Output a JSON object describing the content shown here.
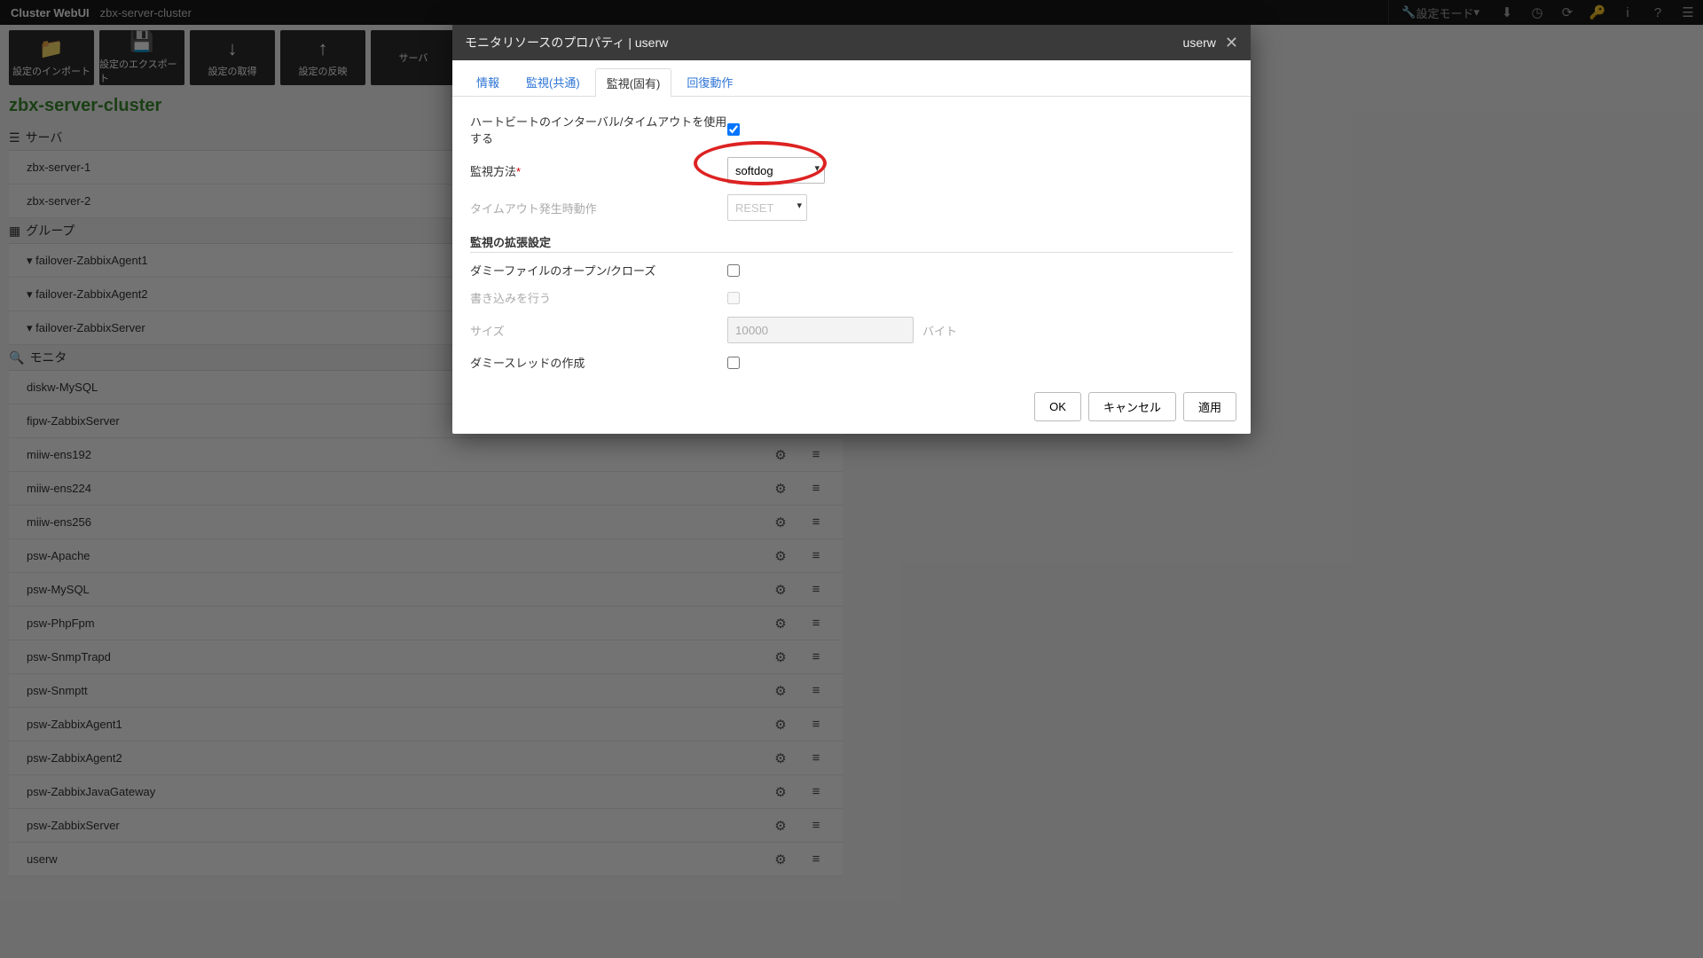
{
  "topbar": {
    "brand_bold": "Cluster WebUI",
    "cluster": "zbx-server-cluster",
    "mode_label": "設定モード",
    "icons": [
      "download",
      "history",
      "refresh",
      "key",
      "info",
      "help",
      "list"
    ]
  },
  "toolbar": [
    {
      "icon": "folder",
      "label": "設定のインポート"
    },
    {
      "icon": "disk",
      "label": "設定のエクスポート"
    },
    {
      "icon": "down",
      "label": "設定の取得"
    },
    {
      "icon": "up",
      "label": "設定の反映"
    },
    {
      "icon": "",
      "label": "サーバ"
    }
  ],
  "cluster_title": "zbx-server-cluster",
  "sections": {
    "servers": {
      "title": "サーバ",
      "items": [
        "zbx-server-1",
        "zbx-server-2"
      ]
    },
    "groups": {
      "title": "グループ",
      "items": [
        "failover-ZabbixAgent1",
        "failover-ZabbixAgent2",
        "failover-ZabbixServer"
      ]
    },
    "monitors": {
      "title": "モニタ",
      "items": [
        "diskw-MySQL",
        "fipw-ZabbixServer",
        "miiw-ens192",
        "miiw-ens224",
        "miiw-ens256",
        "psw-Apache",
        "psw-MySQL",
        "psw-PhpFpm",
        "psw-SnmpTrapd",
        "psw-Snmptt",
        "psw-ZabbixAgent1",
        "psw-ZabbixAgent2",
        "psw-ZabbixJavaGateway",
        "psw-ZabbixServer",
        "userw"
      ]
    }
  },
  "modal": {
    "title_prefix": "モニタリソースのプロパティ | ",
    "title_name": "userw",
    "top_right": "userw",
    "tabs": [
      "情報",
      "監視(共通)",
      "監視(固有)",
      "回復動作"
    ],
    "active_tab": 2,
    "fields": {
      "hb_use": "ハートビートのインターバル/タイムアウトを使用する",
      "hb_use_checked": true,
      "method": "監視方法",
      "method_value": "softdog",
      "timeout_action": "タイムアウト発生時動作",
      "timeout_action_value": "RESET",
      "ext_hdr": "監視の拡張設定",
      "dummy_file": "ダミーファイルのオープン/クローズ",
      "dummy_file_checked": false,
      "do_write": "書き込みを行う",
      "size": "サイズ",
      "size_value": "10000",
      "size_unit": "バイト",
      "dummy_thread": "ダミースレッドの作成",
      "dummy_thread_checked": false
    },
    "buttons": {
      "ok": "OK",
      "cancel": "キャンセル",
      "apply": "適用"
    }
  }
}
